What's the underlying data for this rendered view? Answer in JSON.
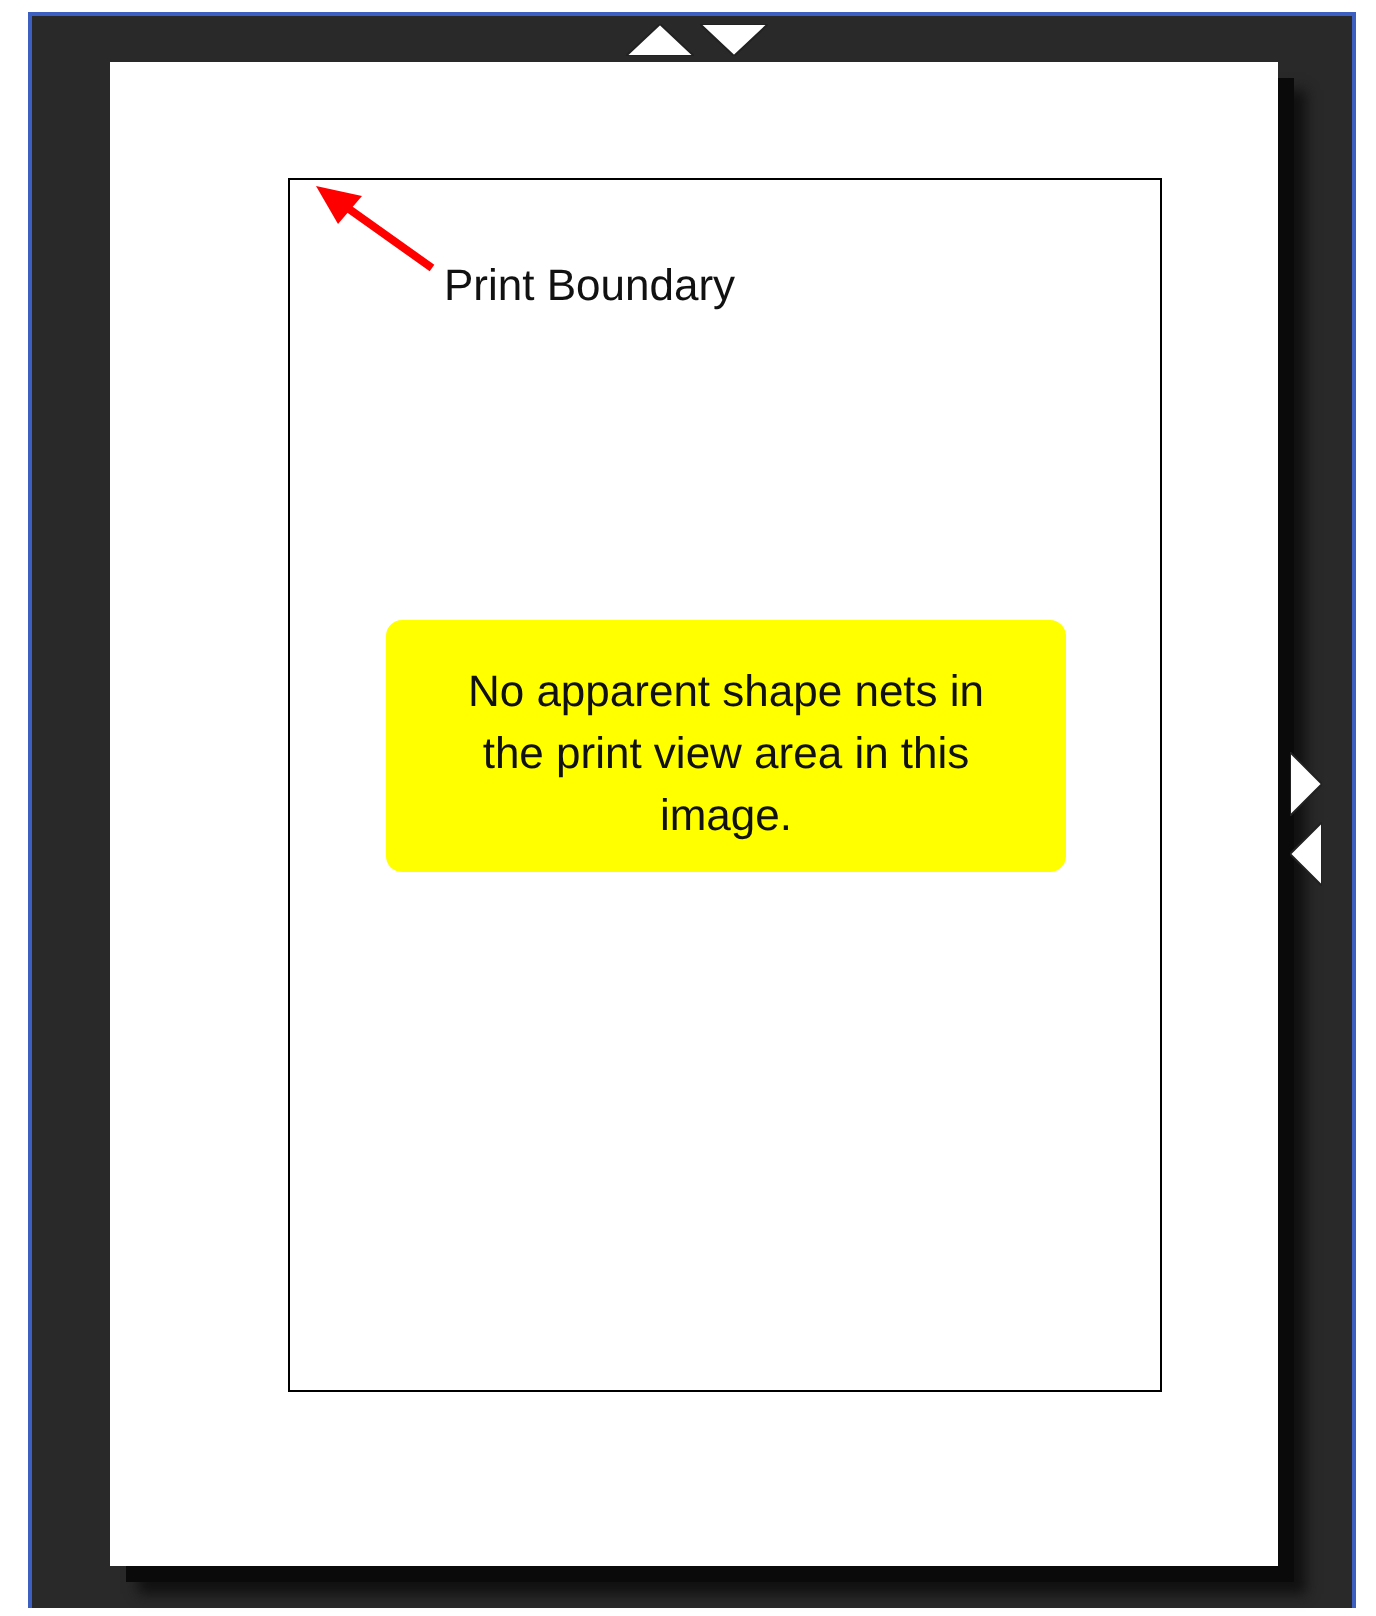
{
  "annotation": {
    "label": "Print Boundary"
  },
  "note": {
    "text": "No apparent shape nets in the print view area in this image."
  }
}
